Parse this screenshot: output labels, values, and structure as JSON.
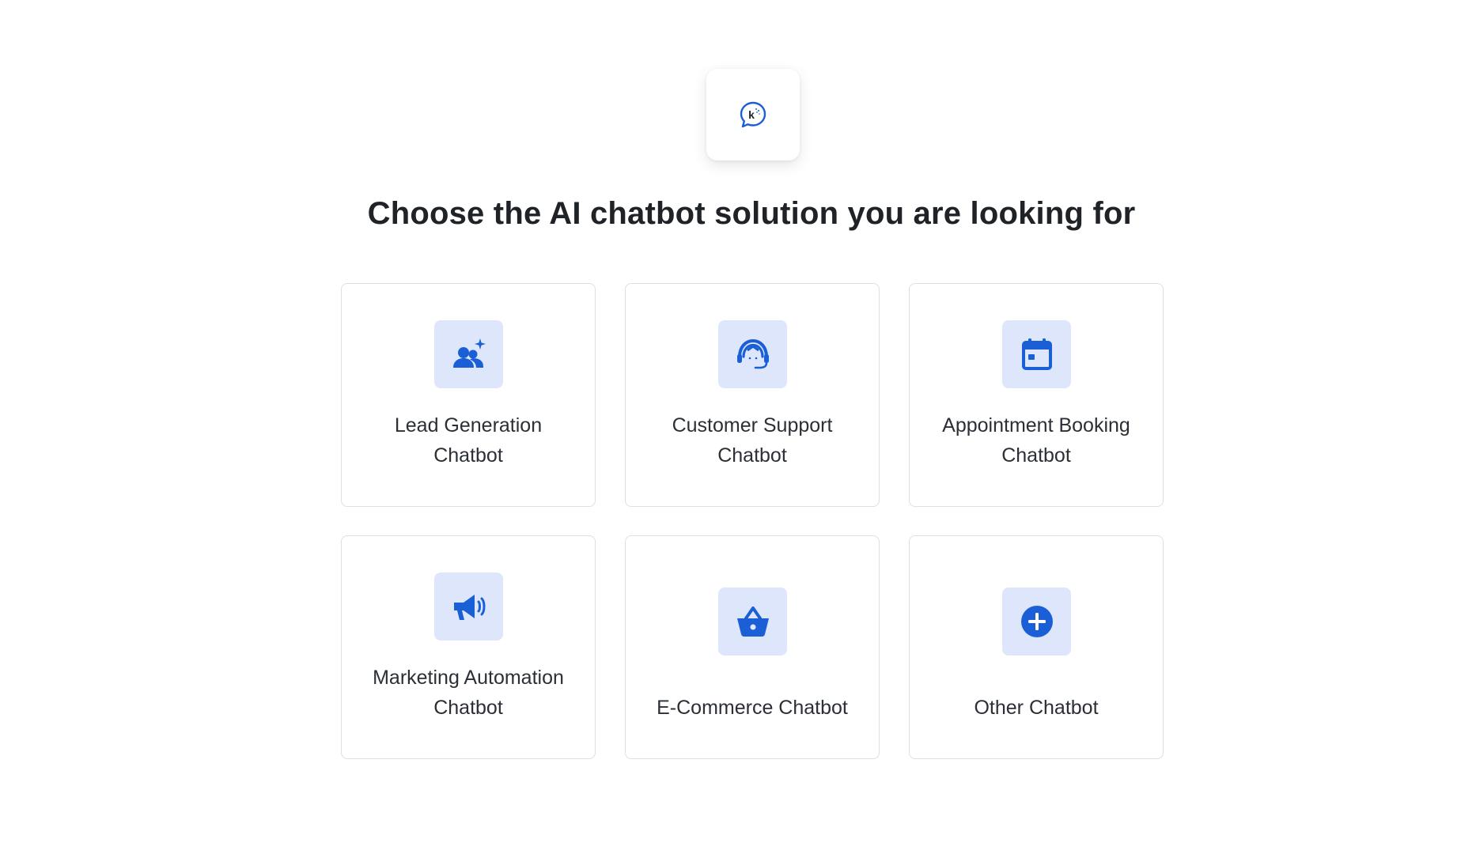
{
  "brand": {
    "logo_letter": "k",
    "accent_color": "#1a5fd6",
    "tile_color": "#dde6fb"
  },
  "page": {
    "title": "Choose the AI chatbot solution you are looking for"
  },
  "options": [
    {
      "line1": "Lead Generation",
      "line2": "Chatbot",
      "icon": "lead-generation-icon"
    },
    {
      "line1": "Customer Support",
      "line2": "Chatbot",
      "icon": "customer-support-headset-icon"
    },
    {
      "line1": "Appointment Booking",
      "line2": "Chatbot",
      "icon": "calendar-icon"
    },
    {
      "line1": "Marketing Automation",
      "line2": "Chatbot",
      "icon": "megaphone-icon"
    },
    {
      "line1": "E-Commerce Chatbot",
      "icon": "shopping-basket-icon"
    },
    {
      "line1": "Other Chatbot",
      "icon": "plus-circle-icon"
    }
  ]
}
